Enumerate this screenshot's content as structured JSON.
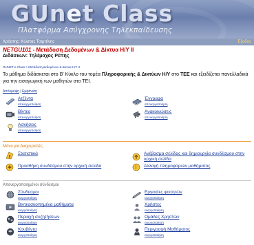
{
  "header": {
    "logo_left": "GUn",
    "logo_e": "e",
    "logo_right": "t Class",
    "tagline": "Πλατφόρμα Ασύγχρονης Τηλεκπαίδευσης"
  },
  "userbar": {
    "user": "Χρήστης: Κώστας Τσιμπίνης",
    "logout": "Έξοδος"
  },
  "course": {
    "code": "NETGU101",
    "title": " - Μετάδοση Δεδομένων & Δίκτυα Η/Υ ΙΙ",
    "teacher": "Διδάσκων: Τηλέμαχος Ρέπης"
  },
  "breadcrumb": "GUNET e-Class > Μετάδοση Δεδομένων & Δίκτυα Η/Υ ΙΙ",
  "description": {
    "pre": "Το μάθημα διδάσκεται στο Β' Κύκλο του τομέα ",
    "bold1": "Πληροφορικής & Δικτύων Η/Υ",
    "mid": " στο ",
    "bold2": "ΤΕΕ",
    "post": " και εξειδίζεται πανελλαδικά για την εισαγωγική των μαθητών στο ΤΕΙ."
  },
  "toggle": {
    "a": "Απόκρυψη",
    "sep": " | ",
    "b": "Εμφάνιση"
  },
  "tools_active": [
    {
      "label": "Ατζέντα",
      "action": "απενεργοποίηση",
      "icon": "calendar-icon"
    },
    {
      "label": "Έγγραφα",
      "action": "απενεργοποίηση",
      "icon": "documents-icon"
    },
    {
      "label": "Βίντεο",
      "action": "απενεργοποίηση",
      "icon": "video-icon"
    },
    {
      "label": "Ανακοινώσεις",
      "action": "απενεργοποίηση",
      "icon": "announcements-icon"
    },
    {
      "label": "Ασκήσεις",
      "action": "απενεργοποίηση",
      "icon": "exercises-icon"
    }
  ],
  "admin": {
    "title": "Μόνο για Διαχειριστές",
    "items": [
      {
        "label": "Στατιστικά",
        "icon": "statistics-icon"
      },
      {
        "label": "Ανέβασμα σελίδας και δημιουργία συνδέσμου στην αρχική σελίδα",
        "icon": "upload-page-icon"
      },
      {
        "label": "Προσθήκη συνδέσμου στην αρχική σελίδα",
        "icon": "add-link-icon"
      },
      {
        "label": "Αλλαγή πληροφοριών μαθήματος",
        "icon": "course-info-icon"
      }
    ]
  },
  "inactive": {
    "title": "Απενεργοποιημένοι σύνδεσμοι",
    "items": [
      {
        "label": "Σύνδεσμοι",
        "action": "ενεργοποίηση",
        "icon": "links-icon"
      },
      {
        "label": "Εργασίες φοιτητών",
        "action": "ενεργοποίηση",
        "icon": "student-papers-icon"
      },
      {
        "label": "Βιντεοσκοπημένα μαθήματα",
        "action": "ενεργοποίηση",
        "icon": "video-lessons-icon"
      },
      {
        "label": "Χρήστες",
        "action": "ενεργοποίηση",
        "icon": "users-icon"
      },
      {
        "label": "Περιοχή συζητήσεων",
        "action": "ενεργοποίηση",
        "icon": "forum-icon"
      },
      {
        "label": "Ομάδες Χρηστών",
        "action": "ενεργοποίηση",
        "icon": "user-groups-icon"
      },
      {
        "label": "Κουβέντα",
        "action": "ενεργοποίηση",
        "icon": "chat-icon"
      },
      {
        "label": "Περιγραφή Μαθήματος",
        "action": "ενεργοποίηση",
        "icon": "course-description-icon"
      }
    ]
  },
  "colors": {
    "link": "#1a3c9c",
    "course_red": "#c00000",
    "section_orange": "#e07a10",
    "banner": "#7a8cb6"
  }
}
